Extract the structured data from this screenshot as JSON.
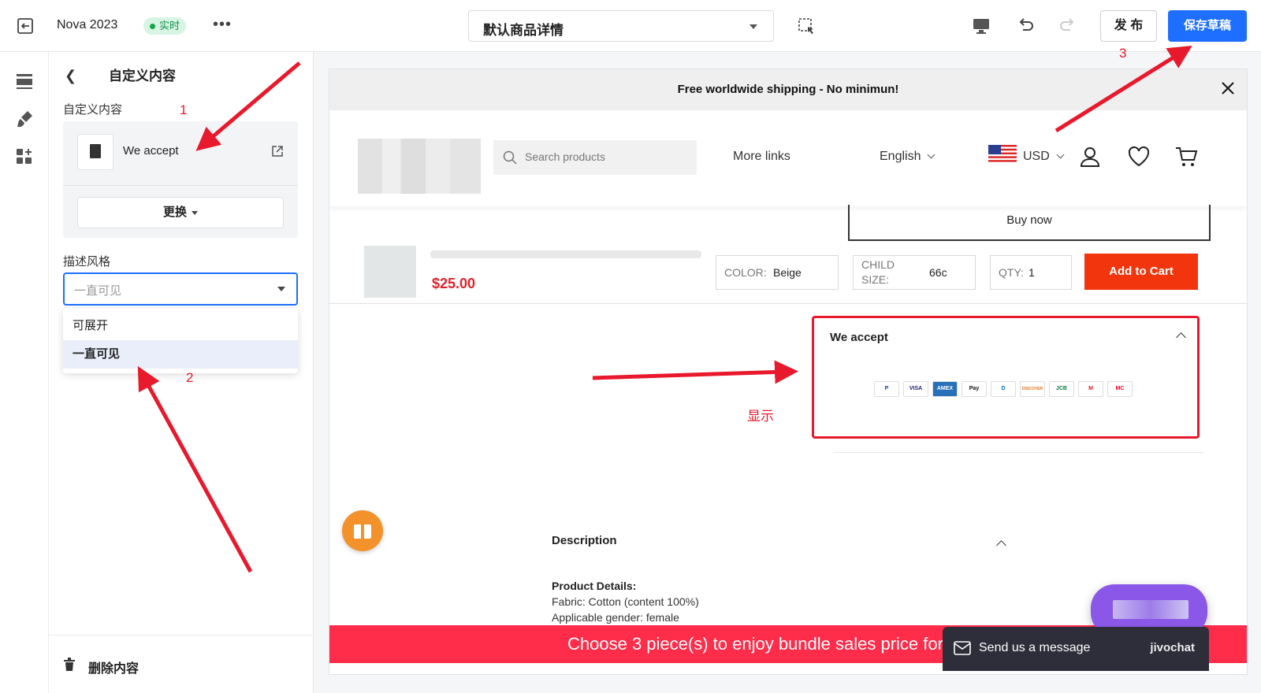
{
  "topbar": {
    "title": "Nova 2023",
    "badge": "实时",
    "template_select": "默认商品详情",
    "publish_label": "发 布",
    "save_label": "保存草稿"
  },
  "panel": {
    "header": "自定义内容",
    "section_label": "自定义内容",
    "content_name": "We accept",
    "replace_label": "更换",
    "style_label": "描述风格",
    "style_placeholder": "一直可见",
    "options": [
      "可展开",
      "一直可见"
    ],
    "selected_option": "一直可见",
    "delete_label": "删除内容"
  },
  "preview": {
    "announcement": "Free worldwide shipping - No minimun!",
    "search_placeholder": "Search products",
    "more_links": "More links",
    "language": "English",
    "currency": "USD",
    "buy_now": "Buy now",
    "price": "$25.00",
    "color_label": "COLOR:",
    "color_value": "Beige",
    "size_label_1": "CHILD",
    "size_label_2": "SIZE:",
    "size_value": "66c",
    "qty_label": "QTY:",
    "qty_value": "1",
    "add_to_cart": "Add to Cart",
    "accept_title": "We accept",
    "payment_icons": [
      "P",
      "VISA",
      "AMEX",
      "Pay",
      "D",
      "DISCOVER",
      "JCB",
      "M",
      "MC"
    ],
    "description_title": "Description",
    "product_details_title": "Product Details:",
    "detail_line_1": "Fabric: Cotton (content 100%)",
    "detail_line_2": "Applicable gender: female",
    "promo": "Choose 3 piece(s) to enjoy bundle sales price for $",
    "chat_prompt": "Send us a message",
    "chat_brand": "jivochat"
  },
  "annotations": {
    "step1": "1",
    "step2": "2",
    "step3": "3",
    "display_note": "显示"
  },
  "colors": {
    "accent_blue": "#1e6fff",
    "annotation_red": "#e8192c",
    "add_to_cart": "#f2350c",
    "promo_bar": "#ff2c4a"
  }
}
